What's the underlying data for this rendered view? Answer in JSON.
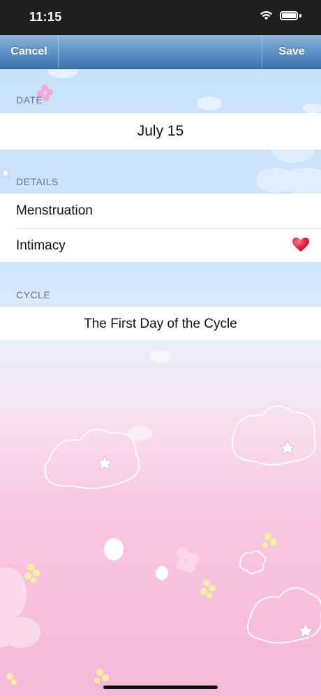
{
  "status_bar": {
    "time": "11:15"
  },
  "navbar": {
    "cancel_label": "Cancel",
    "save_label": "Save"
  },
  "sections": {
    "date": {
      "header": "DATE",
      "value": "July 15"
    },
    "details": {
      "header": "DETAILS",
      "items": [
        {
          "label": "Menstruation",
          "icon": "none"
        },
        {
          "label": "Intimacy",
          "icon": "heart-icon"
        }
      ]
    },
    "cycle": {
      "header": "CYCLE",
      "value": "The First Day of the Cycle"
    }
  },
  "colors": {
    "navbar_top": "#8db5dd",
    "navbar_bottom": "#3e74ad",
    "heart": "#e01f3d",
    "background_top": "#c6e1fb",
    "background_bottom": "#f6b9d9"
  }
}
